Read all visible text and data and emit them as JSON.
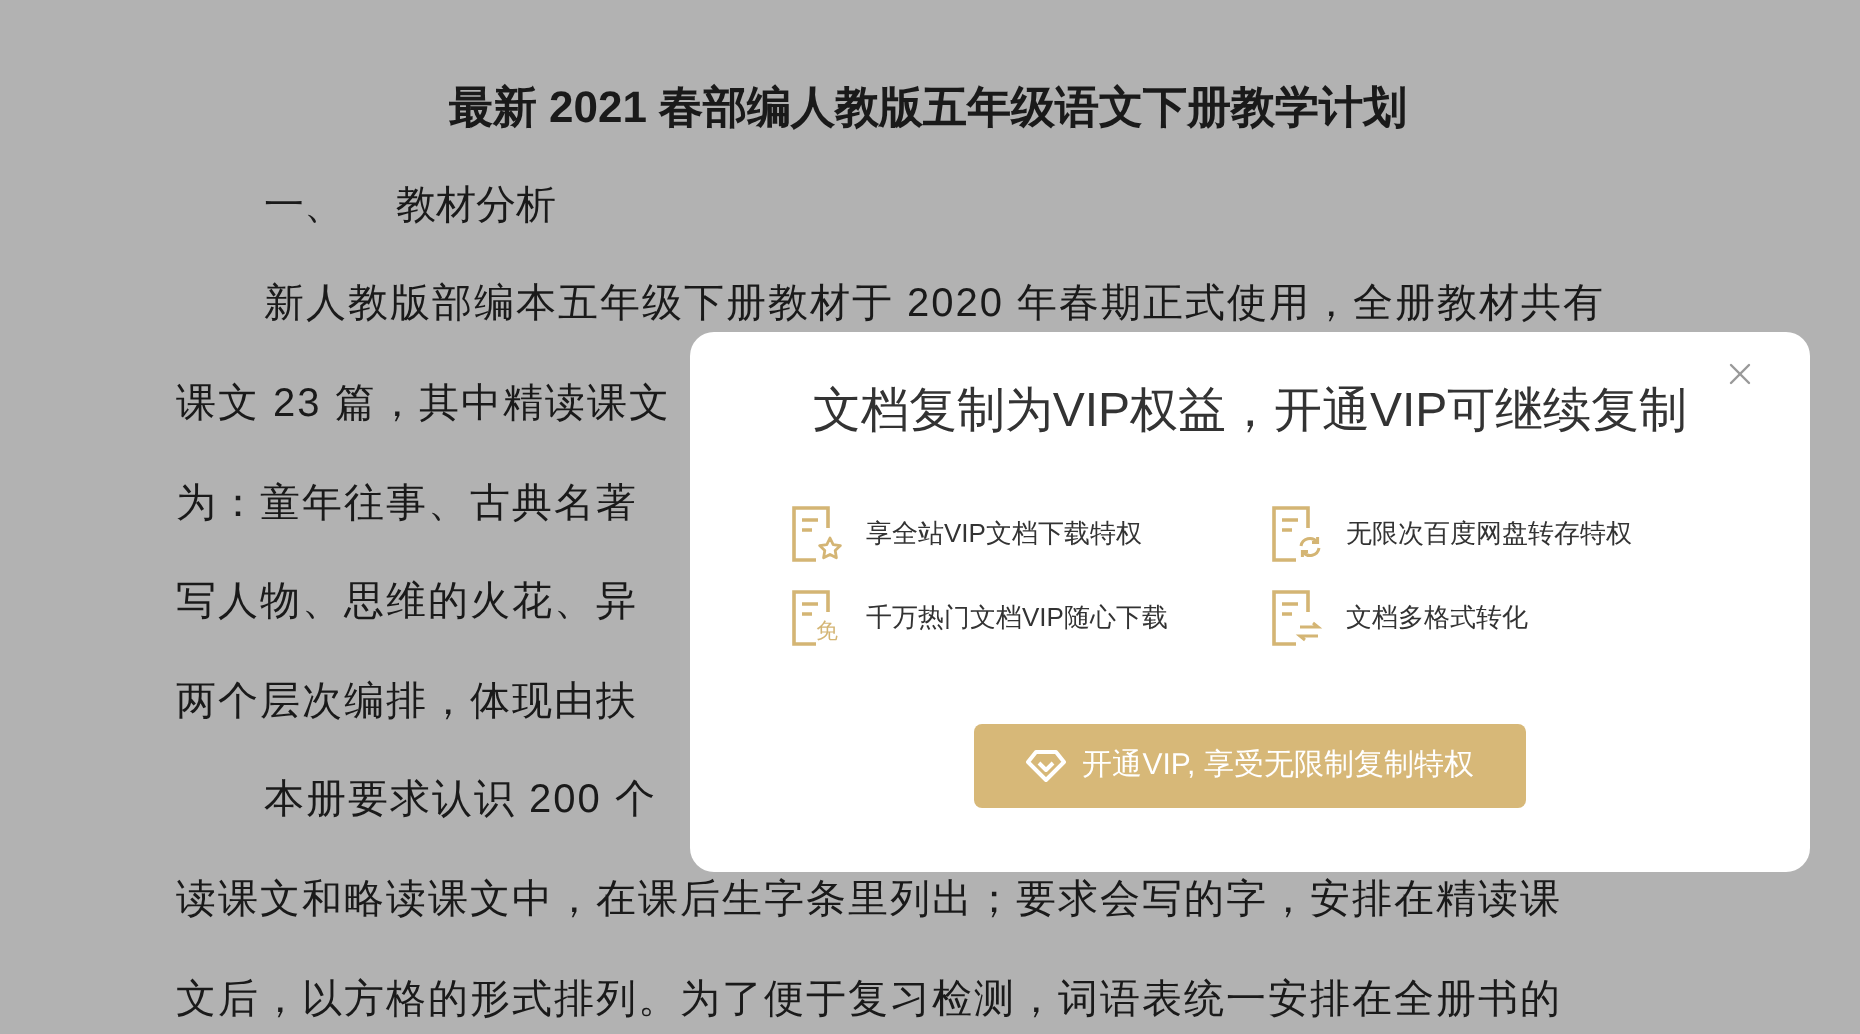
{
  "document": {
    "title": "最新 2021 春部编人教版五年级语文下册教学计划",
    "lines": [
      {
        "kind": "heading",
        "number": "一、",
        "text": "教材分析"
      },
      {
        "kind": "indent",
        "text": "新人教版部编本五年级下册教材于 2020 年春期正式使用，全册教材共有"
      },
      {
        "kind": "plain",
        "text": "课文 23 篇，其中精读课文"
      },
      {
        "kind": "plain",
        "text": "为：童年往事、古典名著"
      },
      {
        "kind": "plain",
        "text": "写人物、思维的火花、异"
      },
      {
        "kind": "plain",
        "text": "两个层次编排，体现由扶"
      },
      {
        "kind": "indent",
        "text": "本册要求认识 200 个"
      },
      {
        "kind": "plain",
        "text": "读课文和略读课文中，在课后生字条里列出；要求会写的字，安排在精读课"
      },
      {
        "kind": "plain",
        "text": "文后，以方格的形式排列。为了便于复习检测，词语表统一安排在全册书的"
      }
    ]
  },
  "dialog": {
    "title": "文档复制为VIP权益，开通VIP可继续复制",
    "features": [
      {
        "kind": "star",
        "label": "享全站VIP文档下载特权"
      },
      {
        "kind": "refresh",
        "label": "无限次百度网盘转存特权"
      },
      {
        "kind": "free",
        "badge": "免",
        "label": "千万热门文档VIP随心下载"
      },
      {
        "kind": "convert",
        "label": "文档多格式转化"
      }
    ],
    "button": "开通VIP, 享受无限制复制特权"
  }
}
